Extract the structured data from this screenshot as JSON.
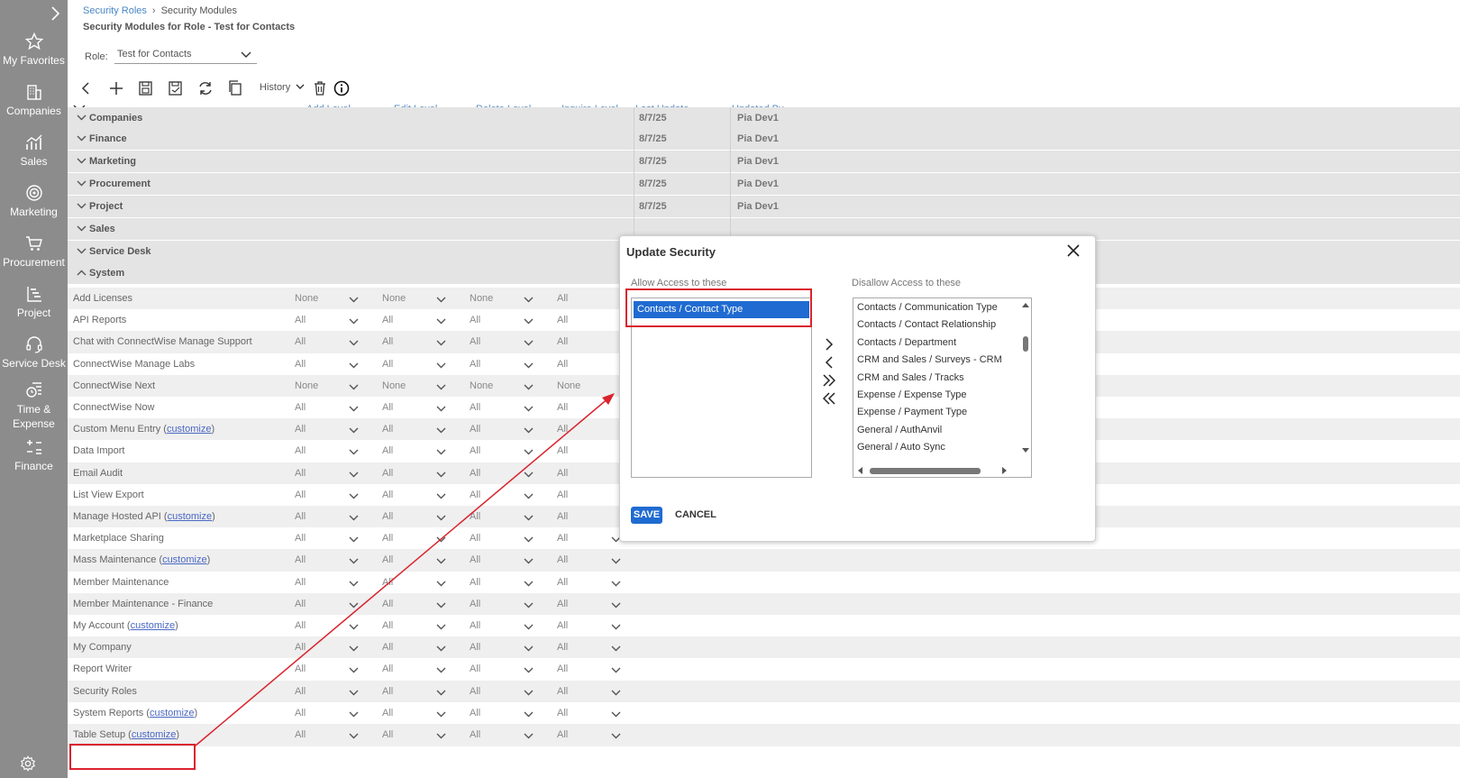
{
  "sidebar": {
    "items": [
      {
        "label": "My Favorites",
        "icon": "star-icon"
      },
      {
        "label": "Companies",
        "icon": "building-icon"
      },
      {
        "label": "Sales",
        "icon": "chart-line-icon"
      },
      {
        "label": "Marketing",
        "icon": "target-icon"
      },
      {
        "label": "Procurement",
        "icon": "cart-icon"
      },
      {
        "label": "Project",
        "icon": "project-icon"
      },
      {
        "label": "Service Desk",
        "icon": "headset-icon"
      },
      {
        "label": "Time &",
        "label2": "Expense",
        "icon": "timesheet-icon"
      },
      {
        "label": "Finance",
        "icon": "finance-icon"
      }
    ]
  },
  "breadcrumb": {
    "parent": "Security Roles",
    "current": "Security Modules"
  },
  "page_title": "Security Modules for Role - Test for Contacts",
  "role": {
    "label": "Role:",
    "value": "Test for Contacts"
  },
  "toolbar": {
    "history_label": "History"
  },
  "columns": {
    "add": "Add Level",
    "edit": "Edit Level",
    "delete": "Delete Level",
    "inquire": "Inquire Level",
    "last_update": "Last Update",
    "updated_by": "Updated By"
  },
  "groups": [
    {
      "name": "Companies",
      "date": "8/7/25",
      "who": "Pia Dev1"
    },
    {
      "name": "Finance",
      "date": "8/7/25",
      "who": "Pia Dev1"
    },
    {
      "name": "Marketing",
      "date": "8/7/25",
      "who": "Pia Dev1"
    },
    {
      "name": "Procurement",
      "date": "8/7/25",
      "who": "Pia Dev1"
    },
    {
      "name": "Project",
      "date": "8/7/25",
      "who": "Pia Dev1"
    },
    {
      "name": "Sales",
      "date": "",
      "who": ""
    },
    {
      "name": "Service Desk",
      "date": "",
      "who": ""
    },
    {
      "name": "System",
      "date": "",
      "who": ""
    }
  ],
  "customize_label": "customize",
  "modules": [
    {
      "name": "Add Licenses",
      "add": "None",
      "edit": "None",
      "delete": "None",
      "inquire": "All"
    },
    {
      "name": "API Reports",
      "add": "All",
      "edit": "All",
      "delete": "All",
      "inquire": "All"
    },
    {
      "name": "Chat with ConnectWise Manage Support",
      "add": "All",
      "edit": "All",
      "delete": "All",
      "inquire": "All"
    },
    {
      "name": "ConnectWise Manage Labs",
      "add": "All",
      "edit": "All",
      "delete": "All",
      "inquire": "All"
    },
    {
      "name": "ConnectWise Next",
      "add": "None",
      "edit": "None",
      "delete": "None",
      "inquire": "None"
    },
    {
      "name": "ConnectWise Now",
      "add": "All",
      "edit": "All",
      "delete": "All",
      "inquire": "All"
    },
    {
      "name": "Custom Menu Entry",
      "add": "All",
      "edit": "All",
      "delete": "All",
      "inquire": "All",
      "custom": true
    },
    {
      "name": "Data Import",
      "add": "All",
      "edit": "All",
      "delete": "All",
      "inquire": "All"
    },
    {
      "name": "Email Audit",
      "add": "All",
      "edit": "All",
      "delete": "All",
      "inquire": "All"
    },
    {
      "name": "List View Export",
      "add": "All",
      "edit": "All",
      "delete": "All",
      "inquire": "All"
    },
    {
      "name": "Manage Hosted API",
      "add": "All",
      "edit": "All",
      "delete": "All",
      "inquire": "All",
      "custom": true
    },
    {
      "name": "Marketplace Sharing",
      "add": "All",
      "edit": "All",
      "delete": "All",
      "inquire": "All"
    },
    {
      "name": "Mass Maintenance",
      "add": "All",
      "edit": "All",
      "delete": "All",
      "inquire": "All",
      "custom": true
    },
    {
      "name": "Member Maintenance",
      "add": "All",
      "edit": "All",
      "delete": "All",
      "inquire": "All"
    },
    {
      "name": "Member Maintenance - Finance",
      "add": "All",
      "edit": "All",
      "delete": "All",
      "inquire": "All"
    },
    {
      "name": "My Account",
      "add": "All",
      "edit": "All",
      "delete": "All",
      "inquire": "All",
      "custom": true
    },
    {
      "name": "My Company",
      "add": "All",
      "edit": "All",
      "delete": "All",
      "inquire": "All"
    },
    {
      "name": "Report Writer",
      "add": "All",
      "edit": "All",
      "delete": "All",
      "inquire": "All"
    },
    {
      "name": "Security Roles",
      "add": "All",
      "edit": "All",
      "delete": "All",
      "inquire": "All"
    },
    {
      "name": "System Reports",
      "add": "All",
      "edit": "All",
      "delete": "All",
      "inquire": "All",
      "custom": true
    },
    {
      "name": "Table Setup",
      "add": "All",
      "edit": "All",
      "delete": "All",
      "inquire": "All",
      "custom": true
    }
  ],
  "dialog": {
    "title": "Update Security",
    "allow_label": "Allow Access to these",
    "disallow_label": "Disallow Access to these",
    "allow_items": [
      "Contacts / Contact Type"
    ],
    "disallow_items": [
      "Contacts / Communication Type",
      "Contacts / Contact Relationship",
      "Contacts / Department",
      "CRM and Sales / Surveys - CRM",
      "CRM and Sales / Tracks",
      "Expense / Expense Type",
      "Expense / Payment Type",
      "General / AuthAnvil",
      "General / Auto Sync"
    ],
    "save_label": "SAVE",
    "cancel_label": "CANCEL"
  },
  "colors": {
    "sidebar": "#8c8c8c",
    "primary": "#1f6bd1",
    "annotation": "#d9232e",
    "link": "#4a86c5"
  }
}
